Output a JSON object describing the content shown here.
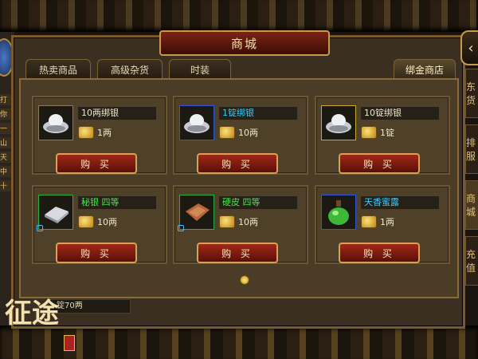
{
  "title": "商城",
  "tabs": [
    {
      "label": "热卖商品"
    },
    {
      "label": "高级杂货"
    },
    {
      "label": "时装"
    },
    {
      "label": "绑金商店"
    }
  ],
  "active_tab": "绑金商店",
  "items": [
    {
      "name": "10两绑银",
      "price": "1两",
      "icon": "silver-ingot-icon",
      "name_color": "#f0e6c8",
      "frame": "plain"
    },
    {
      "name": "1锭绑银",
      "price": "10两",
      "icon": "silver-ingot-icon",
      "name_color": "#33ccff",
      "frame": "blue"
    },
    {
      "name": "10锭绑银",
      "price": "1锭",
      "icon": "silver-ingot-icon",
      "name_color": "#f0e6c8",
      "frame": "plain"
    },
    {
      "name": "秘银 四等",
      "price": "10两",
      "icon": "mithril-bar-icon",
      "name_color": "#4fe04f",
      "frame": "green"
    },
    {
      "name": "硬皮 四等",
      "price": "10两",
      "icon": "hard-leather-icon",
      "name_color": "#4fe04f",
      "frame": "green"
    },
    {
      "name": "天香蜜露",
      "price": "1两",
      "icon": "potion-bottle-icon",
      "name_color": "#33ccff",
      "frame": "blue"
    }
  ],
  "buy_label": "购 买",
  "bottom_balance": "锭70两",
  "right_tabs": [
    "东货",
    "排服",
    "商城",
    "充值"
  ],
  "left_labels": [
    "打",
    "你",
    "一",
    "山夕",
    "天相",
    "中秋",
    "十"
  ],
  "logo_text": "征途",
  "colors": {
    "accent_gold": "#c79a48",
    "button_red": "#a12819"
  }
}
